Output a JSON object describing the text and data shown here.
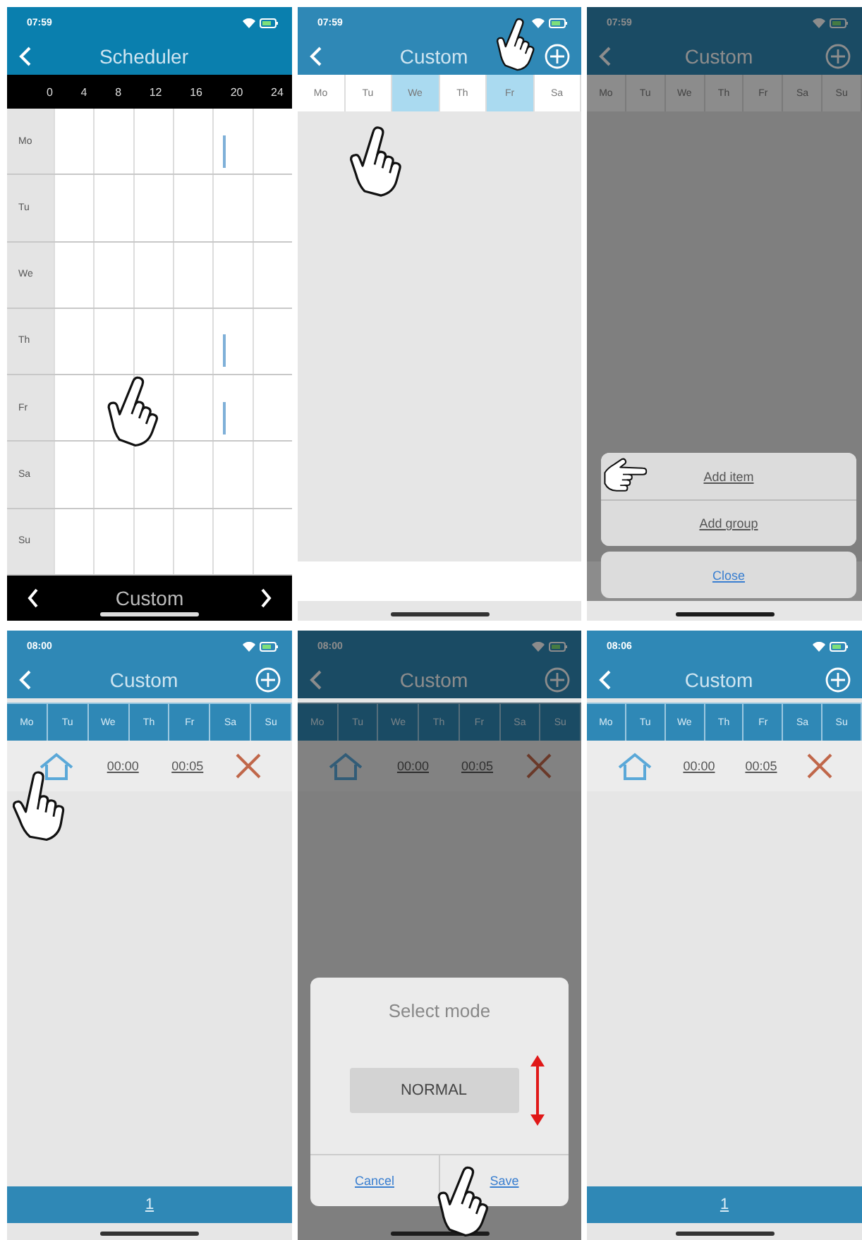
{
  "panels": [
    {
      "kind": "scheduler",
      "dimmed": false,
      "status_time": "07:59",
      "title": "Scheduler",
      "add_button": false,
      "hours": [
        "0",
        "4",
        "8",
        "12",
        "16",
        "20",
        "24"
      ],
      "days": [
        {
          "label": "Mo",
          "has_entry": true
        },
        {
          "label": "Tu",
          "has_entry": false
        },
        {
          "label": "We",
          "has_entry": false
        },
        {
          "label": "Th",
          "has_entry": true
        },
        {
          "label": "Fr",
          "has_entry": true
        },
        {
          "label": "Sa",
          "has_entry": false
        },
        {
          "label": "Su",
          "has_entry": false
        }
      ],
      "bottom_bar": {
        "label": "Custom"
      }
    },
    {
      "kind": "day_picker",
      "dimmed": false,
      "status_time": "07:59",
      "title": "Custom",
      "add_button": true,
      "day_tabs": [
        {
          "label": "Mo",
          "selected": false
        },
        {
          "label": "Tu",
          "selected": false
        },
        {
          "label": "We",
          "selected": true
        },
        {
          "label": "Th",
          "selected": false
        },
        {
          "label": "Fr",
          "selected": true
        },
        {
          "label": "Sa",
          "selected": false
        }
      ]
    },
    {
      "kind": "day_picker",
      "dimmed": true,
      "status_time": "07:59",
      "title": "Custom",
      "add_button": true,
      "day_tabs": [
        {
          "label": "Mo",
          "selected": false
        },
        {
          "label": "Tu",
          "selected": false
        },
        {
          "label": "We",
          "selected": false
        },
        {
          "label": "Th",
          "selected": false
        },
        {
          "label": "Fr",
          "selected": false
        },
        {
          "label": "Sa",
          "selected": false
        },
        {
          "label": "Su",
          "selected": false
        }
      ],
      "action_sheet": {
        "items": [
          "Add item",
          "Add group"
        ],
        "cancel": "Close"
      }
    },
    {
      "kind": "item_list",
      "dimmed": false,
      "status_time": "08:00",
      "title": "Custom",
      "add_button": true,
      "day_tabs": [
        {
          "label": "Mo",
          "selected": false
        },
        {
          "label": "Tu",
          "selected": false
        },
        {
          "label": "We",
          "selected": false
        },
        {
          "label": "Th",
          "selected": false
        },
        {
          "label": "Fr",
          "selected": false
        },
        {
          "label": "Sa",
          "selected": false
        },
        {
          "label": "Su",
          "selected": false
        }
      ],
      "items": [
        {
          "start": "00:00",
          "end": "00:05"
        }
      ],
      "page_bar": {
        "label": "1"
      }
    },
    {
      "kind": "item_list",
      "dimmed": true,
      "status_time": "08:00",
      "title": "Custom",
      "add_button": true,
      "day_tabs": [
        {
          "label": "Mo",
          "selected": false
        },
        {
          "label": "Tu",
          "selected": false
        },
        {
          "label": "We",
          "selected": false
        },
        {
          "label": "Th",
          "selected": false
        },
        {
          "label": "Fr",
          "selected": false
        },
        {
          "label": "Sa",
          "selected": false
        },
        {
          "label": "Su",
          "selected": false
        }
      ],
      "items": [
        {
          "start": "00:00",
          "end": "00:05"
        }
      ],
      "dialog": {
        "title": "Select mode",
        "value": "NORMAL",
        "cancel": "Cancel",
        "save": "Save"
      }
    },
    {
      "kind": "item_list",
      "dimmed": false,
      "status_time": "08:06",
      "title": "Custom",
      "add_button": true,
      "day_tabs": [
        {
          "label": "Mo",
          "selected": false
        },
        {
          "label": "Tu",
          "selected": false
        },
        {
          "label": "We",
          "selected": false
        },
        {
          "label": "Th",
          "selected": false
        },
        {
          "label": "Fr",
          "selected": false
        },
        {
          "label": "Sa",
          "selected": false
        },
        {
          "label": "Su",
          "selected": false
        }
      ],
      "items": [
        {
          "start": "00:00",
          "end": "00:05"
        }
      ],
      "page_bar": {
        "label": "1"
      }
    }
  ]
}
